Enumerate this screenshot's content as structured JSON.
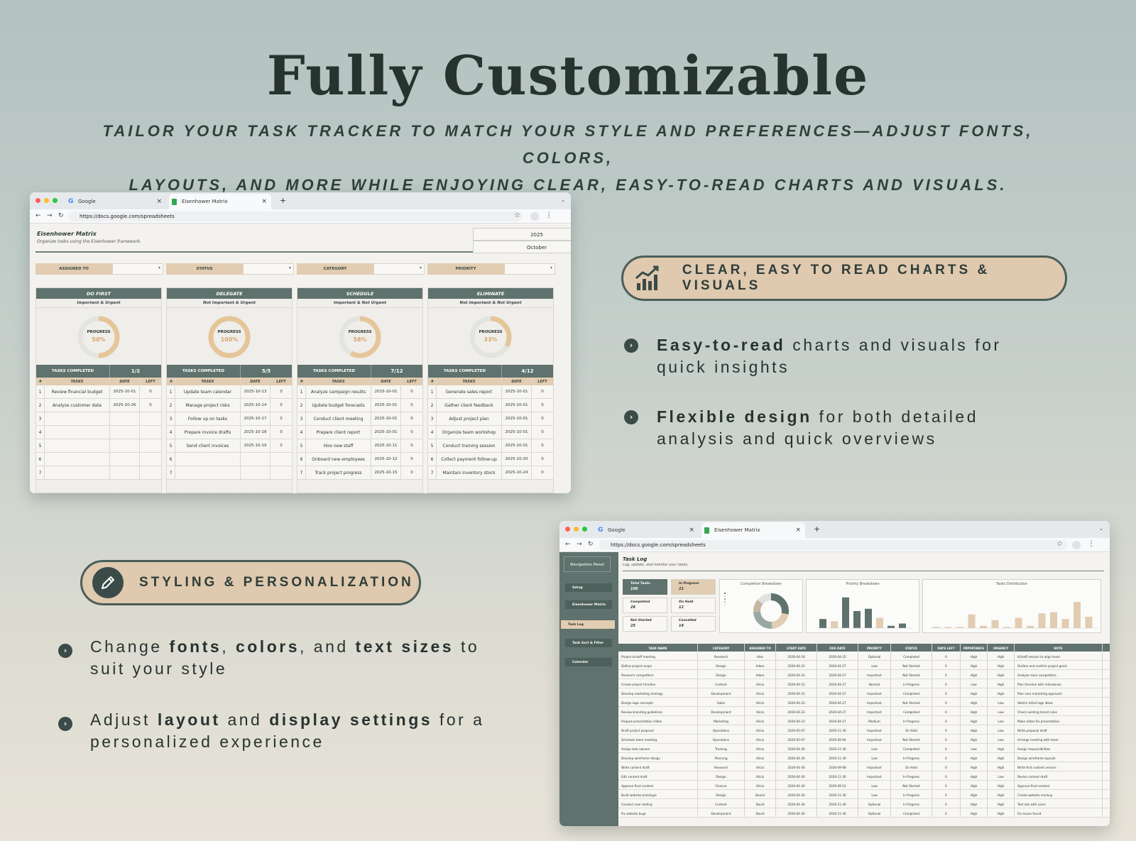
{
  "hero": {
    "title": "Fully Customizable",
    "subtitle_line1": "TAILOR YOUR TASK TRACKER TO MATCH YOUR STYLE AND PREFERENCES—ADJUST FONTS, COLORS,",
    "subtitle_line2": "LAYOUTS, AND MORE WHILE ENJOYING CLEAR, EASY-TO-READ CHARTS AND VISUALS."
  },
  "browser": {
    "tab1": "Google",
    "tab2": "Eisenhower Matrix",
    "url": "https://docs.google.com/spreadsheets",
    "plus": "+",
    "close": "×"
  },
  "matrix": {
    "title": "Eisenhower Matrix",
    "subtitle": "Organize tasks using the Eisenhower framework.",
    "year": "2025",
    "month": "October",
    "filters": [
      "ASSIGNED TO",
      "STATUS",
      "CATEGORY",
      "PRIORITY"
    ],
    "progress_label": "PROGRESS",
    "tasks_completed_label": "TASKS COMPLETED",
    "col_num": "#",
    "col_tasks": "TASKS",
    "col_date": "DATE",
    "col_left": "LEFT",
    "quadrants": [
      {
        "title": "DO FIRST",
        "sub": "Important & Urgent",
        "progress": "50%",
        "fraction": 0.5,
        "completed": "1/2",
        "rows": [
          [
            "1",
            "Review financial budget",
            "2025-10-01",
            "0"
          ],
          [
            "2",
            "Analyze customer data",
            "2025-10-26",
            "0"
          ],
          [
            "3",
            "",
            "",
            ""
          ],
          [
            "4",
            "",
            "",
            ""
          ],
          [
            "5",
            "",
            "",
            ""
          ],
          [
            "6",
            "",
            "",
            ""
          ],
          [
            "7",
            "",
            "",
            ""
          ]
        ]
      },
      {
        "title": "DELEGATE",
        "sub": "Not Important & Urgent",
        "progress": "100%",
        "fraction": 1.0,
        "completed": "5/5",
        "rows": [
          [
            "1",
            "Update team calendar",
            "2025-10-13",
            "0"
          ],
          [
            "2",
            "Manage project risks",
            "2025-10-14",
            "0"
          ],
          [
            "3",
            "Follow up on tasks",
            "2025-10-17",
            "0"
          ],
          [
            "4",
            "Prepare invoice drafts",
            "2025-10-18",
            "0"
          ],
          [
            "5",
            "Send client invoices",
            "2025-10-19",
            "0"
          ],
          [
            "6",
            "",
            "",
            ""
          ],
          [
            "7",
            "",
            "",
            ""
          ]
        ]
      },
      {
        "title": "SCHEDULE",
        "sub": "Important & Not Urgent",
        "progress": "58%",
        "fraction": 0.58,
        "completed": "7/12",
        "rows": [
          [
            "1",
            "Analyze campaign results",
            "2025-10-01",
            "0"
          ],
          [
            "2",
            "Update budget forecasts",
            "2025-10-01",
            "0"
          ],
          [
            "3",
            "Conduct client meeting",
            "2025-10-01",
            "0"
          ],
          [
            "4",
            "Prepare client report",
            "2025-10-01",
            "0"
          ],
          [
            "5",
            "Hire new staff",
            "2025-10-11",
            "0"
          ],
          [
            "6",
            "Onboard new employees",
            "2025-10-12",
            "0"
          ],
          [
            "7",
            "Track project progress",
            "2025-10-15",
            "0"
          ]
        ]
      },
      {
        "title": "ELIMINATE",
        "sub": "Not Important & Not Urgent",
        "progress": "33%",
        "fraction": 0.33,
        "completed": "4/12",
        "rows": [
          [
            "1",
            "Generate sales report",
            "2025-10-01",
            "0"
          ],
          [
            "2",
            "Gather client feedback",
            "2025-10-01",
            "0"
          ],
          [
            "3",
            "Adjust project plan",
            "2025-10-01",
            "0"
          ],
          [
            "4",
            "Organize team workshop",
            "2025-10-01",
            "0"
          ],
          [
            "5",
            "Conduct training session",
            "2025-10-01",
            "0"
          ],
          [
            "6",
            "Collect payment follow-up",
            "2025-10-20",
            "0"
          ],
          [
            "7",
            "Maintain inventory stock",
            "2025-10-24",
            "0"
          ]
        ]
      }
    ]
  },
  "features": {
    "charts_pill": "CLEAR, EASY TO READ CHARTS & VISUALS",
    "charts_b1_bold": "Easy-to-read",
    "charts_b1_rest": " charts and visuals for",
    "charts_b1_line2": "quick insights",
    "charts_b2_bold": "Flexible design",
    "charts_b2_rest": " for both detailed",
    "charts_b2_line2": "analysis and quick overviews",
    "styling_pill": "STYLING & PERSONALIZATION",
    "s1_a": "Change ",
    "s1_b1": "fonts",
    "s1_c": ", ",
    "s1_b2": "colors",
    "s1_d": ", and ",
    "s1_b3": "text sizes",
    "s1_e": " to",
    "s1_line2": "suit your style",
    "s2_a": "Adjust ",
    "s2_b1": "layout",
    "s2_c": " and ",
    "s2_b2": "display settings",
    "s2_d": " for a",
    "s2_line2": "personalized experience",
    "bullet_glyph": "›"
  },
  "tasklog": {
    "nav_title": "Navigation Panel",
    "nav_items": [
      "Setup",
      "Eisenhower Matrix",
      "Task Log",
      "Task Sort & Filter",
      "Calendar"
    ],
    "title": "Task Log",
    "subtitle": "Log, update, and monitor your tasks.",
    "kpis": [
      {
        "label": "Total Tasks",
        "value": "100"
      },
      {
        "label": "In Progress",
        "value": "21"
      },
      {
        "label": "Completed",
        "value": "28"
      },
      {
        "label": "On Hold",
        "value": "12"
      },
      {
        "label": "Not Started",
        "value": "25"
      },
      {
        "label": "Cancelled",
        "value": "14"
      }
    ],
    "chart_titles": [
      "Completion Breakdown",
      "Priority Breakdown",
      "Tasks Distribution"
    ],
    "columns": [
      "TASK NAME",
      "CATEGORY",
      "ASSIGNED TO",
      "START DATE",
      "DUE DATE",
      "PRIORITY",
      "STATUS",
      "DAYS LEFT",
      "IMPORTANCE",
      "URGENCY",
      "NOTE"
    ],
    "rows": [
      [
        "Project kickoff meeting",
        "Research",
        "Alex",
        "2026-04-18",
        "2026-04-25",
        "Optional",
        "Completed",
        "0",
        "High",
        "High",
        "Kickoff session to align team"
      ],
      [
        "Define project scope",
        "Design",
        "Adam",
        "2026-04-23",
        "2026-04-27",
        "Low",
        "Not Started",
        "0",
        "High",
        "High",
        "Outline and confirm project goals"
      ],
      [
        "Research competitors",
        "Design",
        "Adam",
        "2026-04-23",
        "2026-04-27",
        "Important",
        "Not Started",
        "0",
        "High",
        "High",
        "Analyze main competitors"
      ],
      [
        "Create project timeline",
        "Content",
        "Alicia",
        "2026-04-23",
        "2026-04-27",
        "Normal",
        "In Progress",
        "0",
        "Low",
        "High",
        "Plan timeline with milestones"
      ],
      [
        "Develop marketing strategy",
        "Development",
        "Alicia",
        "2026-04-23",
        "2026-04-27",
        "Important",
        "Completed",
        "0",
        "High",
        "High",
        "Plan core marketing approach"
      ],
      [
        "Design logo concepts",
        "Sales",
        "Alicia",
        "2026-04-23",
        "2026-04-27",
        "Important",
        "Not Started",
        "0",
        "High",
        "Low",
        "Sketch initial logo ideas"
      ],
      [
        "Review branding guidelines",
        "Development",
        "Alicia",
        "2026-04-23",
        "2026-04-27",
        "Important",
        "Completed",
        "0",
        "High",
        "Low",
        "Check existing brand rules"
      ],
      [
        "Prepare presentation slides",
        "Marketing",
        "Alicia",
        "2026-04-23",
        "2026-04-27",
        "Medium",
        "In Progress",
        "0",
        "High",
        "Low",
        "Make slides for presentation"
      ],
      [
        "Draft project proposal",
        "Operations",
        "Alicia",
        "2026-05-07",
        "2026-11-30",
        "Important",
        "On Hold",
        "0",
        "High",
        "Low",
        "Write proposal draft"
      ],
      [
        "Schedule team meeting",
        "Operations",
        "Alicia",
        "2026-05-07",
        "2026-09-04",
        "Important",
        "Not Started",
        "0",
        "High",
        "Low",
        "Arrange meeting with team"
      ],
      [
        "Assign task owners",
        "Training",
        "Alicia",
        "2026-04-30",
        "2026-11-30",
        "Low",
        "Completed",
        "0",
        "Low",
        "High",
        "Assign responsibilities"
      ],
      [
        "Develop wireframe design",
        "Planning",
        "Alicia",
        "2026-04-30",
        "2026-11-30",
        "Low",
        "In Progress",
        "0",
        "High",
        "High",
        "Design wireframe layouts"
      ],
      [
        "Write content draft",
        "Research",
        "Alicia",
        "2026-04-30",
        "2026-09-08",
        "Important",
        "On Hold",
        "0",
        "High",
        "High",
        "Write first content version"
      ],
      [
        "Edit content draft",
        "Design",
        "Alicia",
        "2026-04-30",
        "2026-11-30",
        "Important",
        "In Progress",
        "0",
        "High",
        "Low",
        "Revise content draft"
      ],
      [
        "Approve final content",
        "Finance",
        "Alicia",
        "2026-04-30",
        "2026-09-12",
        "Low",
        "Not Started",
        "0",
        "High",
        "High",
        "Approve final content"
      ],
      [
        "Build website prototype",
        "Design",
        "Daniel",
        "2026-04-30",
        "2026-11-30",
        "Low",
        "In Progress",
        "0",
        "High",
        "High",
        "Create website mockup"
      ],
      [
        "Conduct user testing",
        "Content",
        "David",
        "2026-04-30",
        "2026-11-30",
        "Optional",
        "In Progress",
        "0",
        "High",
        "High",
        "Test site with users"
      ],
      [
        "Fix website bugs",
        "Development",
        "David",
        "2026-04-30",
        "2026-11-30",
        "Optional",
        "Completed",
        "0",
        "High",
        "High",
        "Fix issues found"
      ]
    ]
  },
  "colors": {
    "accent_dark": "#5f726d",
    "accent_tan": "#e2cdb2",
    "ring": "#d6a66c"
  }
}
